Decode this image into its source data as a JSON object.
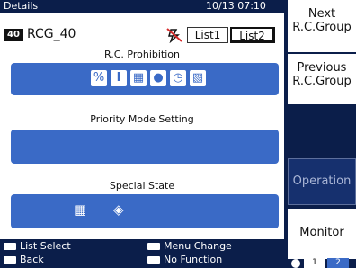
{
  "header": {
    "title": "Details",
    "datetime": "10/13 07:10"
  },
  "group": {
    "number": "40",
    "name": "RCG_40"
  },
  "tabs": [
    {
      "label": "List1"
    },
    {
      "label": "List2"
    }
  ],
  "sections": {
    "rc_prohibition": {
      "title": "R.C. Prohibition"
    },
    "priority_mode": {
      "title": "Priority Mode Setting"
    },
    "special_state": {
      "title": "Special State"
    }
  },
  "right_buttons": {
    "next": "Next R.C.Group",
    "previous": "Previous R.C.Group",
    "operation": "Operation",
    "monitor": "Monitor"
  },
  "footer": {
    "list_select": "List Select",
    "menu_change": "Menu Change",
    "back": "Back",
    "no_function": "No Function"
  },
  "page": {
    "current": "1",
    "next": "2"
  }
}
